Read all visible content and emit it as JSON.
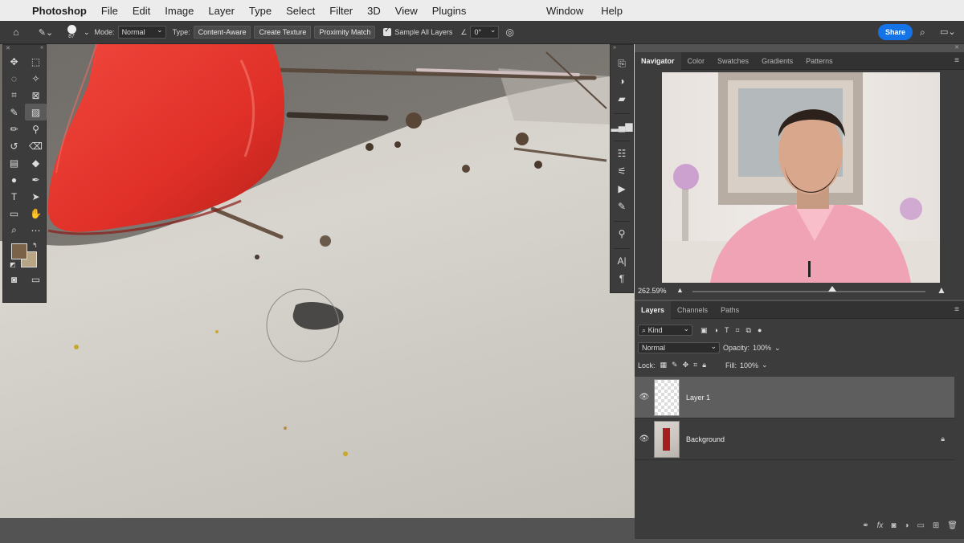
{
  "menubar": {
    "app_name": "Photoshop",
    "items": [
      "File",
      "Edit",
      "Image",
      "Layer",
      "Type",
      "Select",
      "Filter",
      "3D",
      "View",
      "Plugins"
    ],
    "right_items": [
      "Window",
      "Help"
    ]
  },
  "options_bar": {
    "brush_size": "87",
    "mode_label": "Mode:",
    "mode_value": "Normal",
    "type_label": "Type:",
    "type_buttons": [
      "Content-Aware",
      "Create Texture",
      "Proximity Match"
    ],
    "sample_all_layers": "Sample All Layers",
    "angle_value": "0°",
    "share_label": "Share"
  },
  "navigator": {
    "tabs": [
      "Navigator",
      "Color",
      "Swatches",
      "Gradients",
      "Patterns"
    ],
    "zoom": "262.59%",
    "zoom_slider_fraction": 0.6
  },
  "layers_panel": {
    "tabs": [
      "Layers",
      "Channels",
      "Paths"
    ],
    "filter_kind": "Kind",
    "blend_mode": "Normal",
    "opacity_label": "Opacity:",
    "opacity_value": "100%",
    "lock_label": "Lock:",
    "fill_label": "Fill:",
    "fill_value": "100%",
    "layers": [
      {
        "name": "Layer 1",
        "selected": true,
        "locked": false
      },
      {
        "name": "Background",
        "selected": false,
        "locked": true
      }
    ]
  },
  "colors": {
    "foreground": "#7a6248",
    "background": "#b8a586",
    "share_button": "#1473e6",
    "shoe": "#e8352e"
  }
}
